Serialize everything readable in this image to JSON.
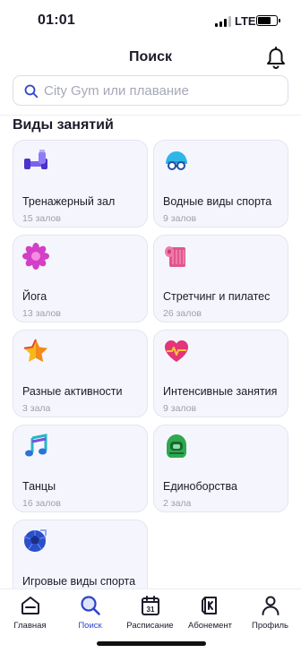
{
  "status_bar": {
    "time": "01:01",
    "network": "LTE"
  },
  "header": {
    "title": "Поиск",
    "bell_icon": "bell-icon"
  },
  "search": {
    "placeholder": "City Gym или плавание",
    "value": "",
    "icon": "search-icon"
  },
  "section": {
    "title": "Виды занятий"
  },
  "categories": [
    {
      "title": "Тренажерный зал",
      "count": "15 залов",
      "icon": "dumbbell-icon"
    },
    {
      "title": "Водные виды спорта",
      "count": "9 залов",
      "icon": "swim-cap-icon"
    },
    {
      "title": "Йога",
      "count": "13 залов",
      "icon": "lotus-icon"
    },
    {
      "title": "Стретчинг и пилатес",
      "count": "26 залов",
      "icon": "yoga-mat-icon"
    },
    {
      "title": "Разные активности",
      "count": "3 зала",
      "icon": "star-icon"
    },
    {
      "title": "Интенсивные занятия",
      "count": "9 залов",
      "icon": "heart-pulse-icon"
    },
    {
      "title": "Танцы",
      "count": "16 залов",
      "icon": "music-note-icon"
    },
    {
      "title": "Единоборства",
      "count": "2 зала",
      "icon": "boxing-helmet-icon"
    },
    {
      "title": "Игровые виды спорта",
      "count": "",
      "icon": "ball-icon"
    }
  ],
  "tabbar": {
    "items": [
      {
        "label": "Главная",
        "icon": "home-icon",
        "active": false
      },
      {
        "label": "Поиск",
        "icon": "search-icon",
        "active": true
      },
      {
        "label": "Расписание",
        "icon": "calendar-icon",
        "active": false,
        "icon_text": "31"
      },
      {
        "label": "Абонемент",
        "icon": "membership-card-icon",
        "active": false
      },
      {
        "label": "Профиль",
        "icon": "profile-icon",
        "active": false
      }
    ]
  },
  "colors": {
    "accent": "#2c43c9",
    "card_bg": "#f5f6fd",
    "muted_text": "#9c9eae"
  }
}
